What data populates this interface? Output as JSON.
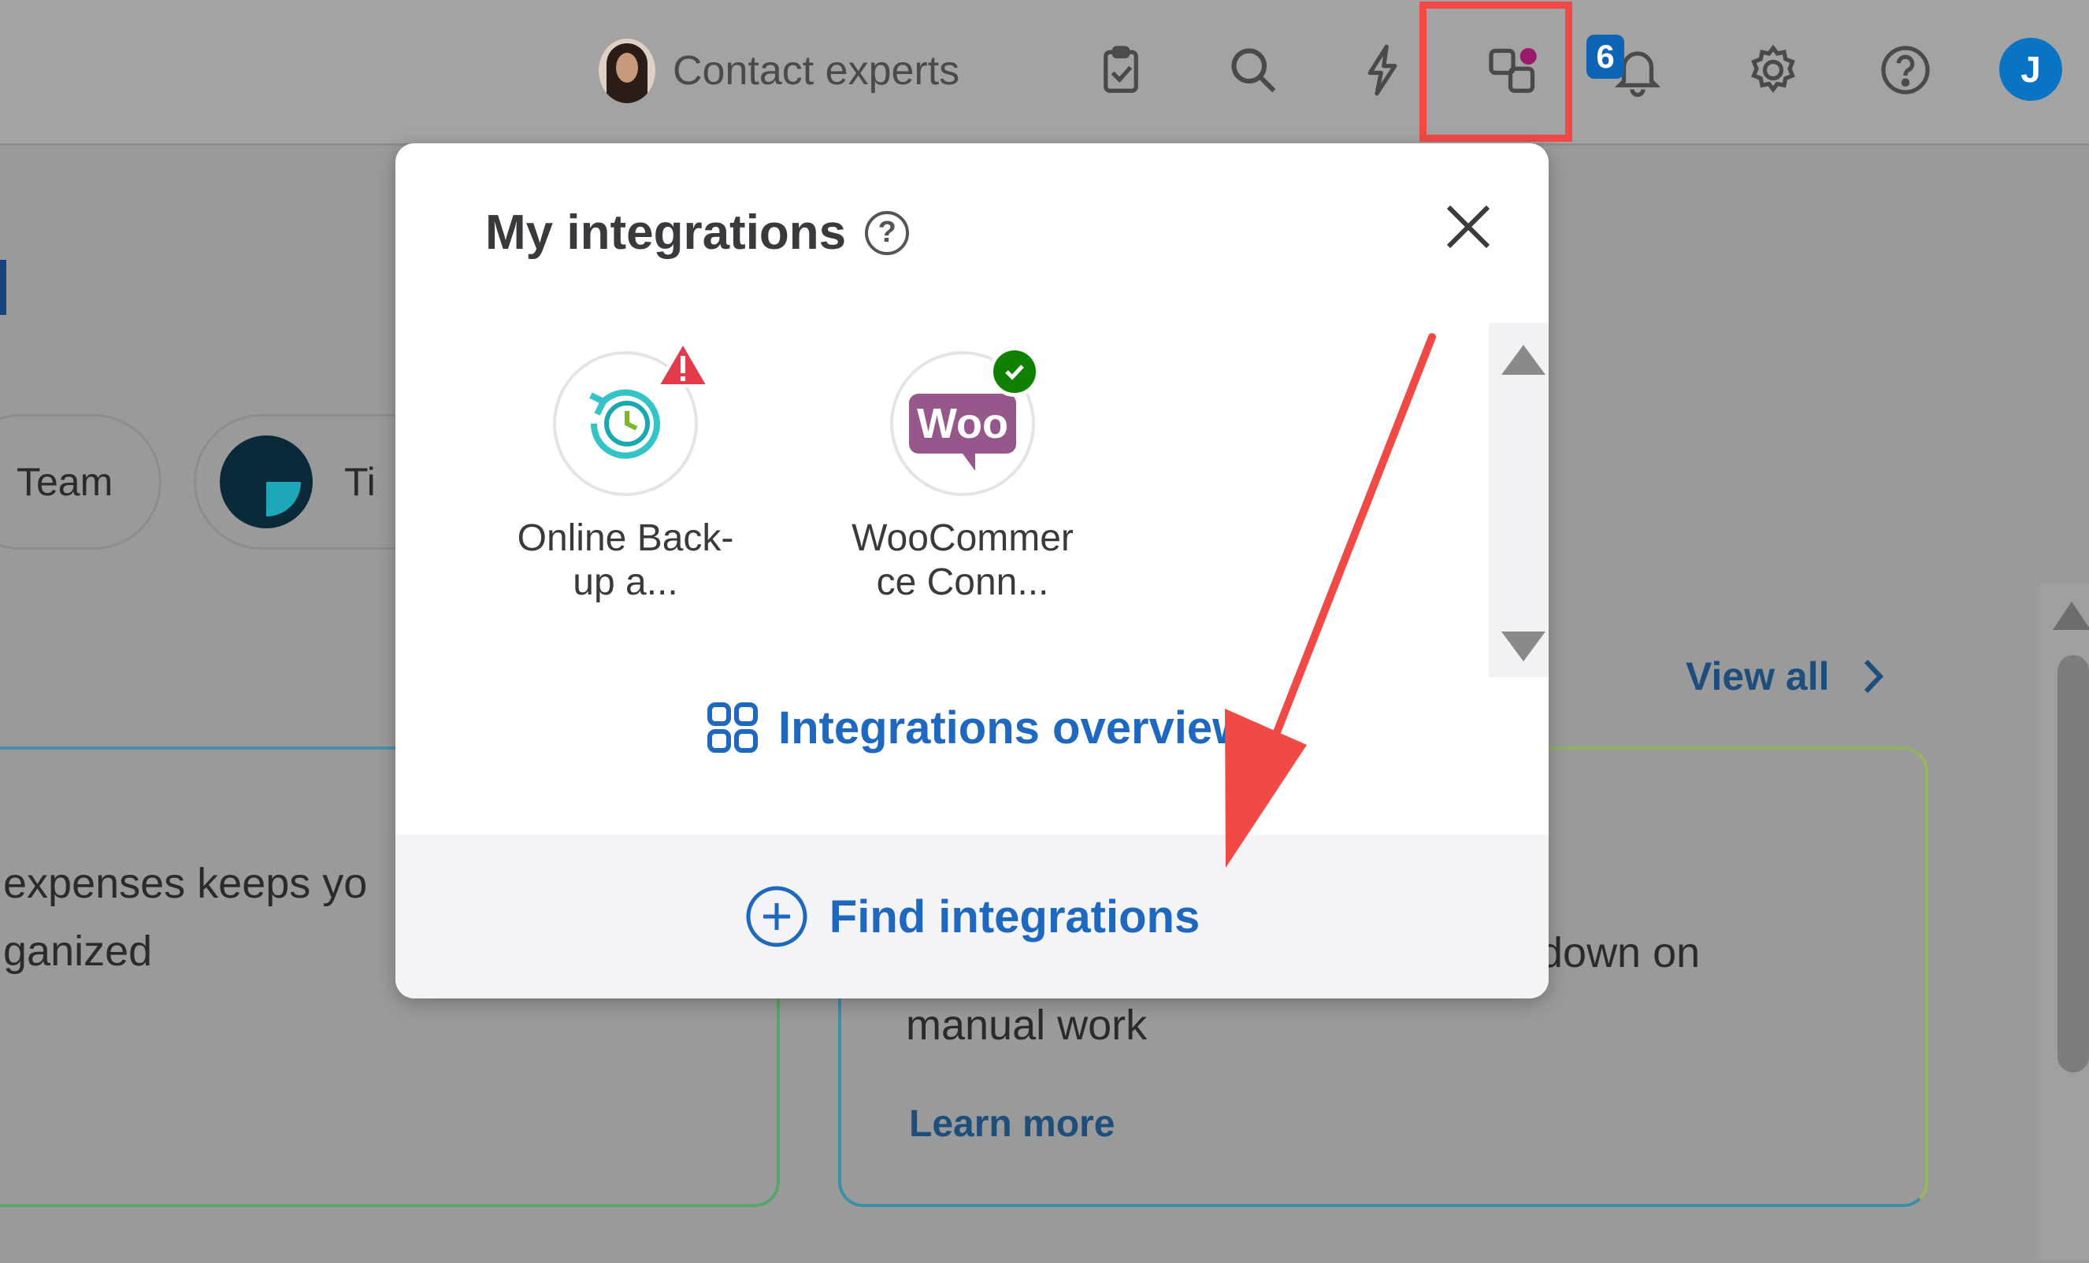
{
  "header": {
    "contact_label": "Contact experts",
    "notification_count": "6",
    "user_initial": "J",
    "icons": [
      "tasks-icon",
      "search-icon",
      "lightning-icon",
      "integrations-icon",
      "bell-icon",
      "gear-icon",
      "help-icon"
    ]
  },
  "background": {
    "chips": [
      "Team",
      "Ti"
    ],
    "view_all": "View all",
    "cards": [
      {
        "line1": "expenses keeps yo",
        "line2": "ganized"
      },
      {
        "line1": "down on",
        "line2": "manual work",
        "link": "Learn more"
      }
    ]
  },
  "popup": {
    "title": "My integrations",
    "apps": [
      {
        "name_line1": "Online Back-",
        "name_line2": "up a...",
        "status": "warning"
      },
      {
        "name_line1": "WooCommer",
        "name_line2": "ce Conn...",
        "status": "connected",
        "logo_text": "Woo"
      }
    ],
    "overview_label": "Integrations overview",
    "find_label": "Find integrations"
  },
  "colors": {
    "accent": "#1f68c0",
    "highlight": "#f14a46",
    "warning": "#e33a4c",
    "success": "#108000",
    "woo": "#96588a"
  }
}
